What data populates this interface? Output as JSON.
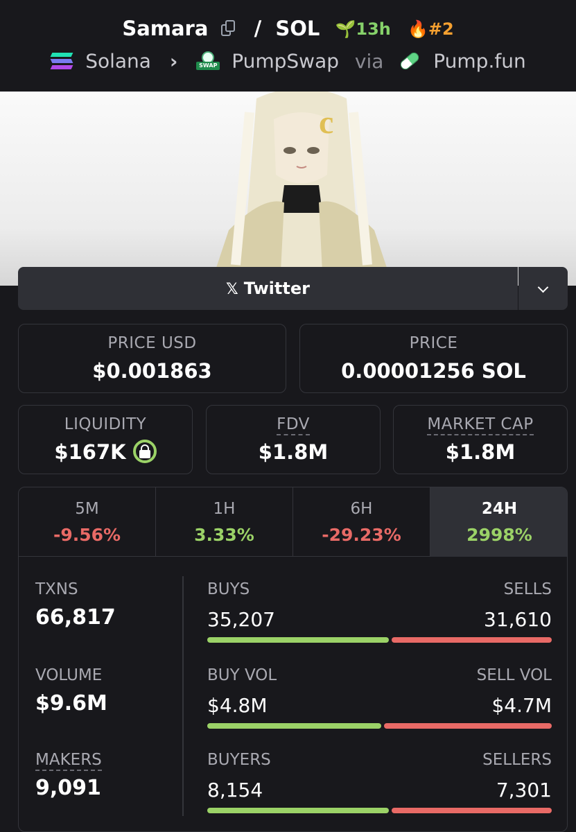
{
  "header": {
    "token_name": "Samara",
    "quote": "SOL",
    "age": "13h",
    "rank": "#2",
    "chain": "Solana",
    "dex": "PumpSwap",
    "via": "via",
    "launchpad": "Pump.fun",
    "swap_tag": "SWAP"
  },
  "socials": {
    "primary_label": "Twitter",
    "x_glyph": "𝕏"
  },
  "prices": {
    "price_usd_label": "PRICE USD",
    "price_usd": "$0.001863",
    "price_native_label": "PRICE",
    "price_native": "0.00001256 SOL"
  },
  "metrics": {
    "liquidity_label": "LIQUIDITY",
    "liquidity": "$167K",
    "fdv_label": "FDV",
    "fdv": "$1.8M",
    "mcap_label": "MARKET CAP",
    "mcap": "$1.8M"
  },
  "timeframes": [
    {
      "label": "5M",
      "change": "-9.56%"
    },
    {
      "label": "1H",
      "change": "3.33%"
    },
    {
      "label": "6H",
      "change": "-29.23%"
    },
    {
      "label": "24H",
      "change": "2998%"
    }
  ],
  "stats": {
    "txns_label": "TXNS",
    "txns": "66,817",
    "volume_label": "VOLUME",
    "volume": "$9.6M",
    "makers_label": "MAKERS",
    "makers": "9,091",
    "buys_label": "BUYS",
    "buys": "35,207",
    "sells_label": "SELLS",
    "sells": "31,610",
    "buy_vol_label": "BUY VOL",
    "buy_vol": "$4.8M",
    "sell_vol_label": "SELL VOL",
    "sell_vol": "$4.7M",
    "buyers_label": "BUYERS",
    "buyers": "8,154",
    "sellers_label": "SELLERS",
    "sellers": "7,301"
  },
  "colors": {
    "positive": "#9bd267",
    "negative": "#e86a66",
    "age": "#86d16a",
    "rank": "#f5a030"
  }
}
